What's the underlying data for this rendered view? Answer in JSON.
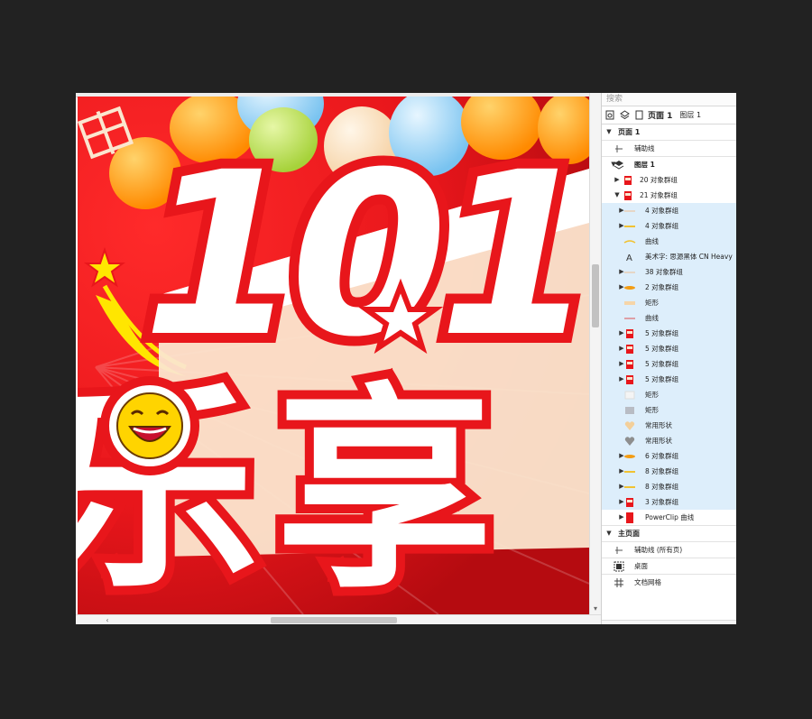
{
  "panel": {
    "search_placeholder": "搜索",
    "toolbar": {
      "page_label": "页面 1",
      "layer_label": "图层 1"
    },
    "items": [
      {
        "label": "页面 1",
        "depth": 0,
        "expand": "open",
        "kind": "section"
      },
      {
        "label": "辅助线",
        "depth": 1,
        "icon": "guideline-icon"
      },
      {
        "label": "图层 1",
        "depth": 1,
        "expand": "open",
        "icon": "layer-icon",
        "bold": true
      },
      {
        "label": "20 对象群组",
        "depth": 2,
        "expand": "closed",
        "icon": "group-thumbnail-red"
      },
      {
        "label": "21 对象群组",
        "depth": 2,
        "expand": "open",
        "icon": "group-thumbnail-red"
      },
      {
        "label": "4 对象群组",
        "depth": 3,
        "expand": "closed",
        "icon": "group-thumbnail-light",
        "selected": true
      },
      {
        "label": "4 对象群组",
        "depth": 3,
        "expand": "closed",
        "icon": "group-thumbnail-yellow",
        "selected": true
      },
      {
        "label": "曲线",
        "depth": 3,
        "icon": "curve-thumbnail-yellow",
        "selected": true
      },
      {
        "label": "美术字: 思源黑体 CN Heavy",
        "depth": 3,
        "icon": "artistic-text-icon",
        "selected": true
      },
      {
        "label": "38 对象群组",
        "depth": 3,
        "expand": "closed",
        "icon": "group-thumbnail-light",
        "selected": true
      },
      {
        "label": "2 对象群组",
        "depth": 3,
        "expand": "closed",
        "icon": "group-thumbnail-orange",
        "selected": true
      },
      {
        "label": "矩形",
        "depth": 3,
        "icon": "rectangle-thumbnail-cream",
        "selected": true
      },
      {
        "label": "曲线",
        "depth": 3,
        "icon": "curve-thumbnail-red",
        "selected": true
      },
      {
        "label": "5 对象群组",
        "depth": 3,
        "expand": "closed",
        "icon": "group-thumbnail-red",
        "selected": true
      },
      {
        "label": "5 对象群组",
        "depth": 3,
        "expand": "closed",
        "icon": "group-thumbnail-red",
        "selected": true
      },
      {
        "label": "5 对象群组",
        "depth": 3,
        "expand": "closed",
        "icon": "group-thumbnail-red",
        "selected": true
      },
      {
        "label": "5 对象群组",
        "depth": 3,
        "expand": "closed",
        "icon": "group-thumbnail-red",
        "selected": true
      },
      {
        "label": "矩形",
        "depth": 3,
        "icon": "rectangle-thumbnail-white",
        "selected": true
      },
      {
        "label": "矩形",
        "depth": 3,
        "icon": "rectangle-thumbnail-gray",
        "selected": true
      },
      {
        "label": "常用形状",
        "depth": 3,
        "icon": "heart-thumbnail-tan",
        "selected": true
      },
      {
        "label": "常用形状",
        "depth": 3,
        "icon": "heart-thumbnail-gray",
        "selected": true
      },
      {
        "label": "6 对象群组",
        "depth": 3,
        "expand": "closed",
        "icon": "group-thumbnail-orange",
        "selected": true
      },
      {
        "label": "8 对象群组",
        "depth": 3,
        "expand": "closed",
        "icon": "group-thumbnail-yellow",
        "selected": true
      },
      {
        "label": "8 对象群组",
        "depth": 3,
        "expand": "closed",
        "icon": "group-thumbnail-yellow",
        "selected": true
      },
      {
        "label": "3 对象群组",
        "depth": 3,
        "expand": "closed",
        "icon": "group-thumbnail-red",
        "selected": true
      },
      {
        "label": "PowerClip 曲线",
        "depth": 3,
        "expand": "closed",
        "icon": "powerclip-thumbnail-red"
      },
      {
        "label": "主页面",
        "depth": 0,
        "expand": "open",
        "kind": "section"
      },
      {
        "label": "辅助线 (所有页)",
        "depth": 1,
        "icon": "guideline-icon"
      },
      {
        "label": "桌面",
        "depth": 1,
        "icon": "desktop-icon"
      },
      {
        "label": "文档网格",
        "depth": 1,
        "icon": "document-grid-icon"
      }
    ]
  },
  "artwork": {
    "headline_text": "101",
    "subtitle_text": "乐享",
    "colors": {
      "red": "#e8161b",
      "dark_red": "#b80a10",
      "cream": "#fbe6cf",
      "white": "#ffffff"
    }
  },
  "scroll": {
    "up_arrow": "▴",
    "down_arrow": "▾",
    "left_arrow": "‹"
  }
}
